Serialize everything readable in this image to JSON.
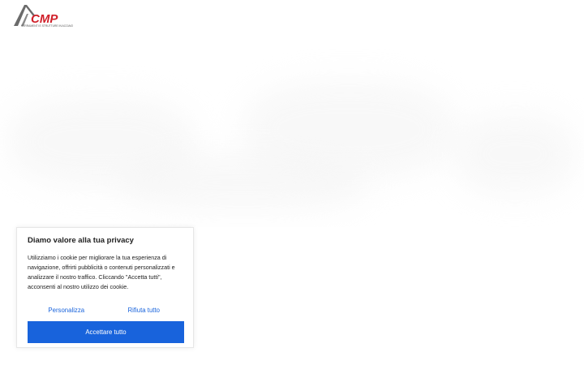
{
  "logo": {
    "brand": "CMP",
    "tagline": "SERRAMENTI E STRUTTURE IN ACCIAIO",
    "colors": {
      "roof": "#6b6b6b",
      "brand": "#d0202a"
    }
  },
  "cookie_banner": {
    "title": "Diamo valore alla tua privacy",
    "body": "Utilizziamo i cookie per migliorare la tua esperienza di navigazione, offrirti pubblicità o contenuti personalizzati e analizzare il nostro traffico. Cliccando \"Accetta tutti\", acconsenti al nostro utilizzo dei cookie.",
    "customize_label": "Personalizza",
    "reject_label": "Rifiuta tutto",
    "accept_label": "Accettare tutto",
    "accent_color": "#1863dc"
  }
}
